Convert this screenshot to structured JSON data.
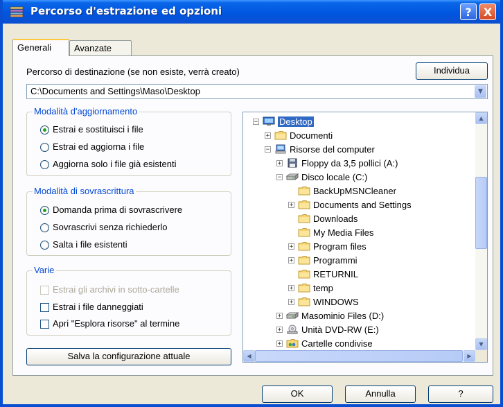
{
  "window": {
    "title": "Percorso d'estrazione ed opzioni",
    "help_label": "?",
    "close_label": "X"
  },
  "tabs": [
    {
      "label": "Generali",
      "active": true
    },
    {
      "label": "Avanzate",
      "active": false
    }
  ],
  "destination": {
    "label": "Percorso di destinazione (se non esiste, verrà creato)",
    "browse_label": "Individua",
    "path": "C:\\Documents and Settings\\Maso\\Desktop"
  },
  "update_mode": {
    "title": "Modalità d'aggiornamento",
    "options": [
      {
        "label": "Estrai e sostituisci i file",
        "selected": true
      },
      {
        "label": "Estrai ed aggiorna i file",
        "selected": false
      },
      {
        "label": "Aggiorna solo i file già esistenti",
        "selected": false
      }
    ]
  },
  "overwrite_mode": {
    "title": "Modalità di sovrascrittura",
    "options": [
      {
        "label": "Domanda prima di sovrascrivere",
        "selected": true
      },
      {
        "label": "Sovrascrivi senza richiederlo",
        "selected": false
      },
      {
        "label": "Salta i file esistenti",
        "selected": false
      }
    ]
  },
  "misc": {
    "title": "Varie",
    "options": [
      {
        "label": "Estrai gli archivi in sotto-cartelle",
        "checked": false,
        "disabled": true
      },
      {
        "label": "Estrai i file danneggiati",
        "checked": false,
        "disabled": false
      },
      {
        "label": "Apri \"Esplora risorse\" al termine",
        "checked": false,
        "disabled": false
      }
    ]
  },
  "save_config_label": "Salva la configurazione attuale",
  "tree": [
    {
      "label": "Desktop",
      "expander": "−",
      "icon": "desktop-icon",
      "selected": true
    },
    {
      "label": "Documenti",
      "expander": "+",
      "icon": "folder-icon"
    },
    {
      "label": "Risorse del computer",
      "expander": "−",
      "icon": "computer-icon"
    },
    {
      "label": "Floppy da 3,5 pollici (A:)",
      "expander": "+",
      "icon": "floppy-icon"
    },
    {
      "label": "Disco locale (C:)",
      "expander": "−",
      "icon": "drive-icon"
    },
    {
      "label": "BackUpMSNCleaner",
      "expander": "",
      "icon": "folder-icon"
    },
    {
      "label": "Documents and Settings",
      "expander": "+",
      "icon": "folder-icon"
    },
    {
      "label": "Downloads",
      "expander": "",
      "icon": "folder-icon"
    },
    {
      "label": "My Media Files",
      "expander": "",
      "icon": "folder-icon"
    },
    {
      "label": "Program files",
      "expander": "+",
      "icon": "folder-icon"
    },
    {
      "label": "Programmi",
      "expander": "+",
      "icon": "folder-icon"
    },
    {
      "label": "RETURNIL",
      "expander": "",
      "icon": "folder-icon"
    },
    {
      "label": "temp",
      "expander": "+",
      "icon": "folder-icon"
    },
    {
      "label": "WINDOWS",
      "expander": "+",
      "icon": "folder-icon"
    },
    {
      "label": "Masominio Files (D:)",
      "expander": "+",
      "icon": "drive-icon"
    },
    {
      "label": "Unità DVD-RW (E:)",
      "expander": "+",
      "icon": "dvd-icon"
    },
    {
      "label": "Cartelle condivise",
      "expander": "+",
      "icon": "shared-folder-icon"
    }
  ],
  "footer": {
    "ok_label": "OK",
    "cancel_label": "Annulla",
    "help_label": "?"
  },
  "colors": {
    "titlebar": "#0056e0",
    "group_title": "#0046d5",
    "selection": "#316ac5",
    "radio_dot": "#21a121"
  }
}
